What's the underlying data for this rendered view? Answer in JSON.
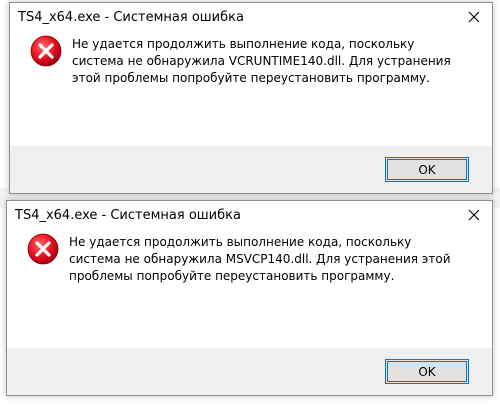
{
  "backdrop": {
    "peek_left": "▁▁▁▁",
    "peek_right": "▁▁▁▁▁▁▁▁▁▁▁"
  },
  "dialogs": [
    {
      "title": "TS4_x64.exe - Системная ошибка",
      "icon": "error-icon",
      "message": "Не удается продолжить выполнение кода, поскольку система не обнаружила VCRUNTIME140.dll. Для устранения этой проблемы попробуйте переустановить программу.",
      "ok_label": "OK"
    },
    {
      "title": "TS4_x64.exe - Системная ошибка",
      "icon": "error-icon",
      "message": "Не удается продолжить выполнение кода, поскольку система не обнаружила MSVCP140.dll. Для устранения этой проблемы попробуйте переустановить программу.",
      "ok_label": "OK"
    }
  ],
  "colors": {
    "error_red": "#e81123",
    "footer_bg": "#f0f0f0",
    "button_border": "#0078d7"
  }
}
